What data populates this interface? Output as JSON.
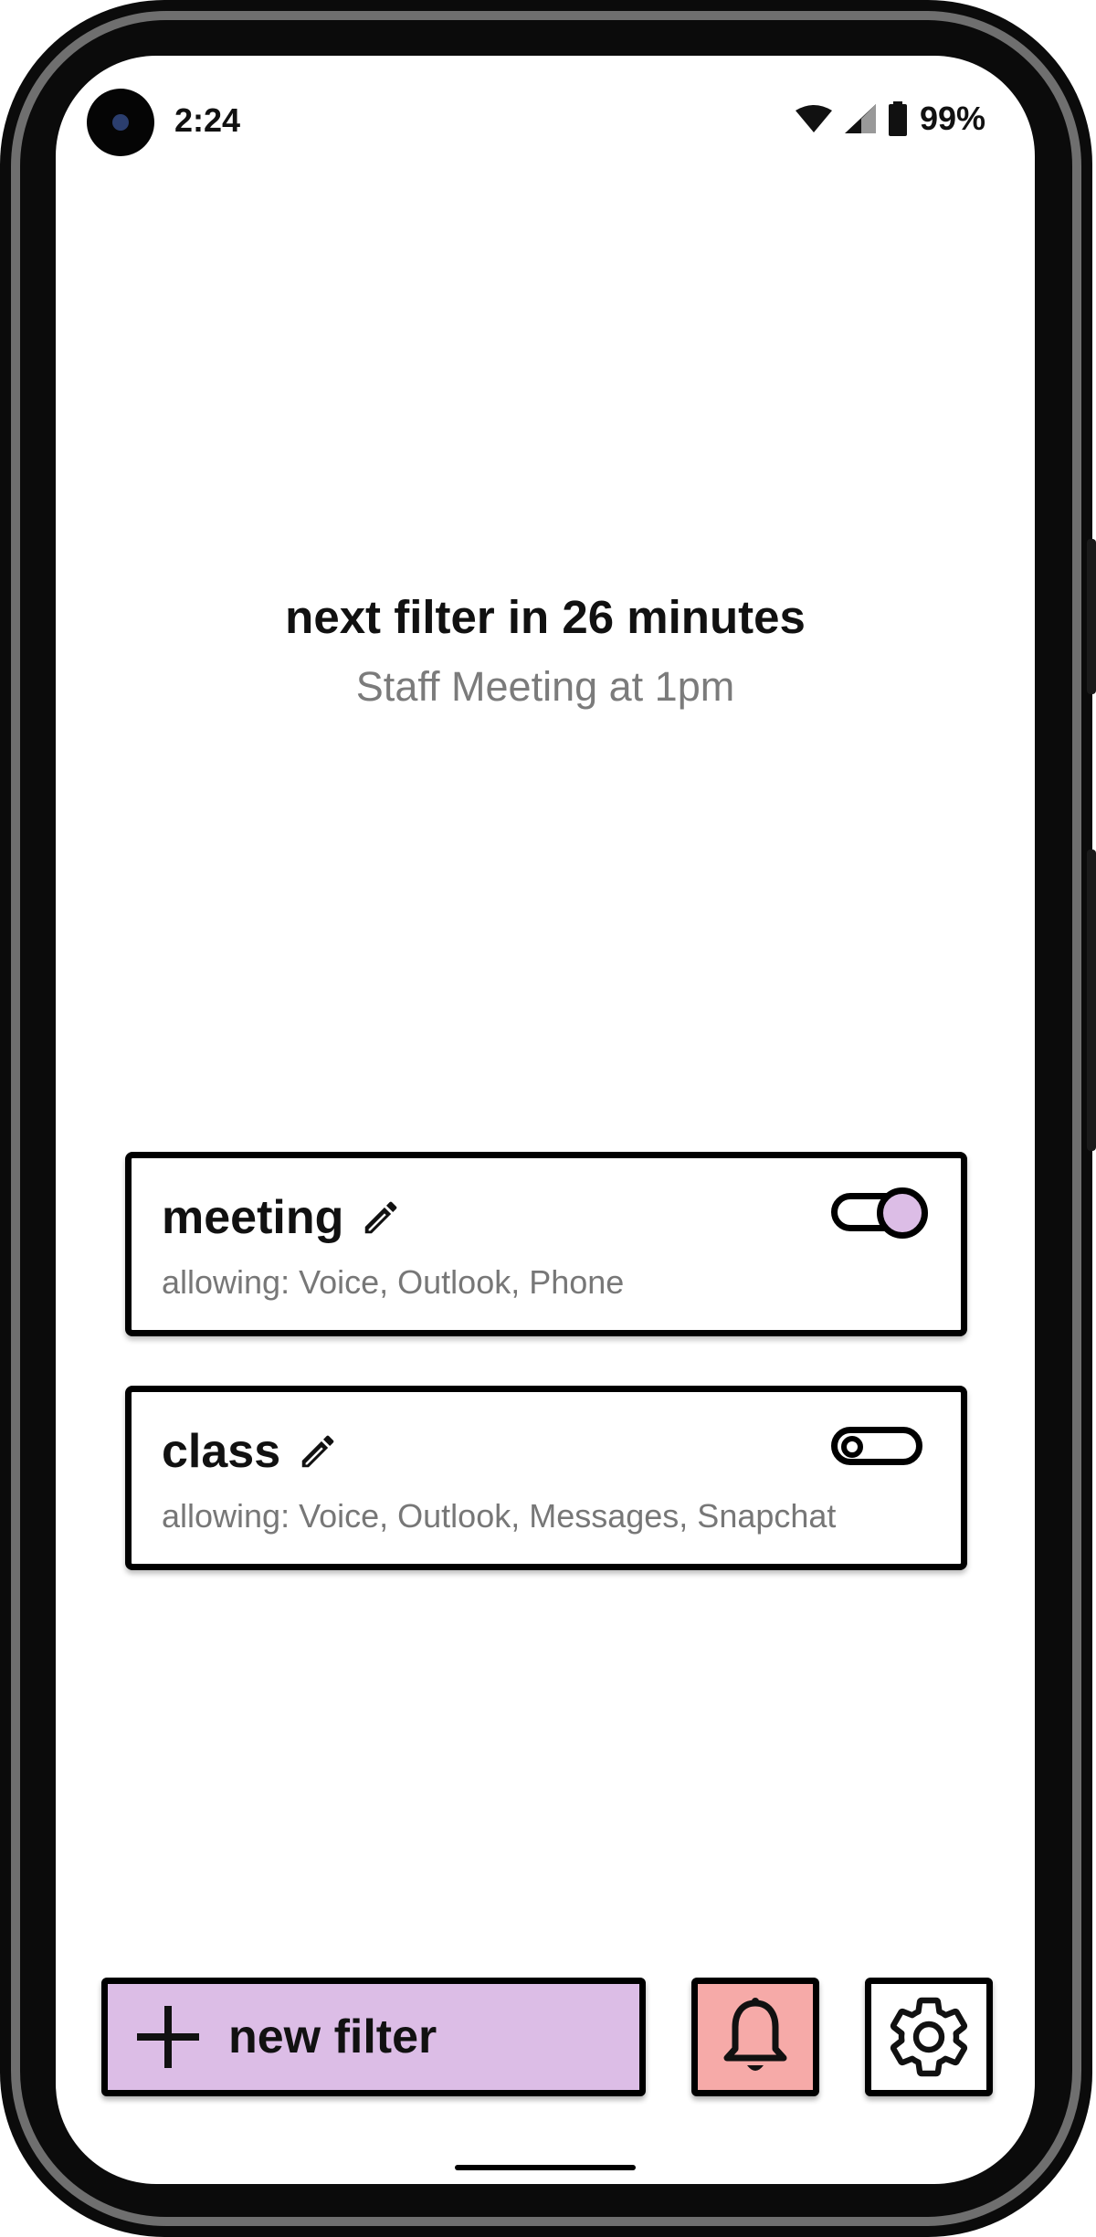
{
  "status_bar": {
    "time": "2:24",
    "battery": "99%",
    "icons": [
      "wifi-icon",
      "signal-icon",
      "battery-icon"
    ]
  },
  "next": {
    "headline": "next filter in 26 minutes",
    "subline": "Staff Meeting at 1pm"
  },
  "filters": [
    {
      "name": "meeting",
      "allowing": "allowing: Voice, Outlook, Phone",
      "enabled": true
    },
    {
      "name": "class",
      "allowing": "allowing: Voice, Outlook, Messages, Snapchat",
      "enabled": false
    }
  ],
  "actions": {
    "new_filter_label": "new filter",
    "new_filter_icon": "plus-icon",
    "notifications_icon": "bell-icon",
    "settings_icon": "gear-icon"
  },
  "colors": {
    "accent_purple": "#dcbde6",
    "bell_red": "#f6aaa8",
    "text_secondary": "#7b7b7b"
  }
}
